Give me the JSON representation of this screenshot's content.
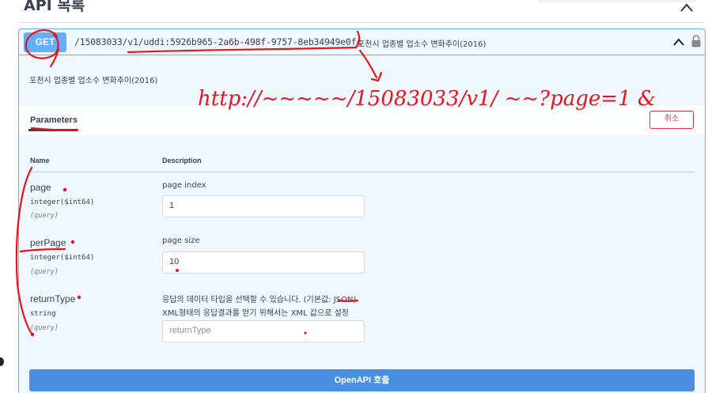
{
  "section": {
    "title": "API 목록"
  },
  "operation": {
    "method": "GET",
    "path": "/15083033/v1/uddi:5926b965-2a6b-498f-9757-8eb34949e0fc",
    "summary": "포천시 업종별 업소수 변화추이(2016)",
    "description": "포천시 업종별 업소수 변화추이(2016)"
  },
  "parameters_bar": {
    "tab_label": "Parameters",
    "cancel_label": "취소"
  },
  "columns": {
    "name": "Name",
    "description": "Description"
  },
  "params": [
    {
      "name": "page",
      "type": "integer($int64)",
      "in": "(query)",
      "description": "page index",
      "value": "1"
    },
    {
      "name": "perPage",
      "type": "integer($int64)",
      "in": "(query)",
      "description": "page size",
      "value": "10"
    },
    {
      "name": "returnType",
      "type": "string",
      "in": "(query)",
      "description_line1": "응답의 데이터 타입을 선택할 수 있습니다. (기본값: JSON)",
      "description_line2": "XML형태의 응답결과를 얻기 위해서는 XML 값으로 설정",
      "placeholder": "returnType"
    }
  ],
  "execute_label": "OpenAPI 호출",
  "annotation": {
    "handwriting": "http://~~~~~/15083033/v1/ ~~?page=1 &"
  },
  "colors": {
    "get": "#61affe",
    "execute": "#4990e2",
    "cancel": "#d8333f",
    "ink": "#e8141c"
  },
  "icons": [
    "chevron-up-icon",
    "lock-icon"
  ]
}
